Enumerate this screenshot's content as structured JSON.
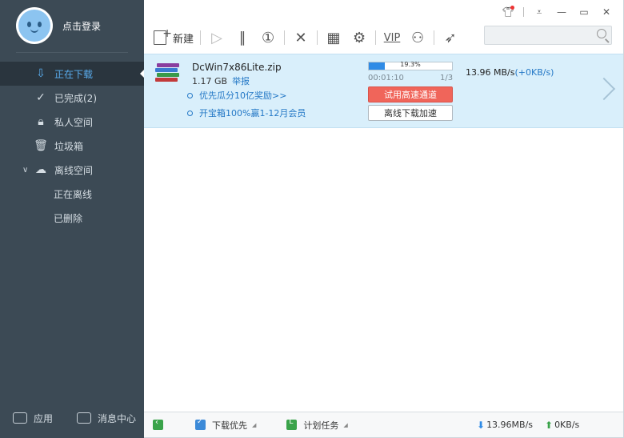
{
  "sidebar": {
    "login_text": "点击登录",
    "items": [
      {
        "label": "正在下载",
        "active": true
      },
      {
        "label": "已完成(2)"
      },
      {
        "label": "私人空间"
      },
      {
        "label": "垃圾箱"
      },
      {
        "label": "离线空间"
      },
      {
        "label": "正在离线"
      },
      {
        "label": "已删除"
      }
    ],
    "footer": {
      "apps_label": "应用",
      "messages_label": "消息中心"
    }
  },
  "toolbar": {
    "new_label": "新建",
    "vip_label": "VIP"
  },
  "search": {
    "placeholder": ""
  },
  "task": {
    "file_name": "DcWin7x86Lite.zip",
    "file_size": "1.17 GB",
    "report_label": "举报",
    "promo1": "优先瓜分10亿奖励>>",
    "promo2": "开宝箱100%赢1-12月会员",
    "progress_text": "19.3%",
    "progress_value": 0.193,
    "elapsed": "00:01:10",
    "segments": "1/3",
    "vip_button": "试用高速通道",
    "offline_button": "离线下载加速",
    "speed": "13.96 MB/s",
    "speed_extra": "(+0KB/s)"
  },
  "statusbar": {
    "priority_label": "下载优先",
    "plan_label": "计划任务",
    "down_speed": "13.96MB/s",
    "up_speed": "0KB/s"
  },
  "colors": {
    "sidebar_bg": "#3c4a55",
    "active_blue": "#5aaef0",
    "row_bg": "#d9effb",
    "vip_red": "#f0655a",
    "progress_blue": "#2f8be6"
  }
}
